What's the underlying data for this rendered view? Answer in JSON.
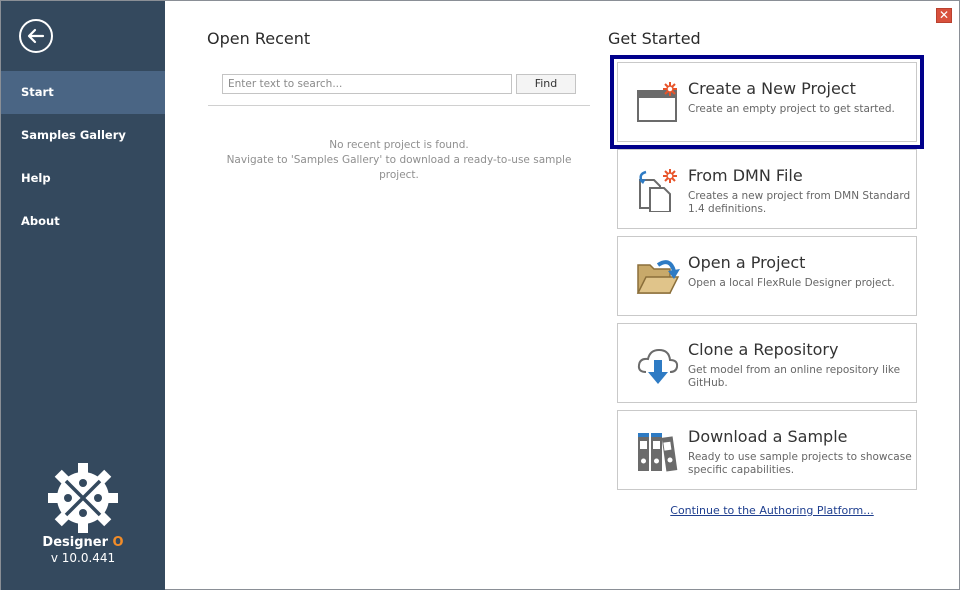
{
  "window": {
    "close_icon": "close-icon"
  },
  "sidebar": {
    "back_icon": "back-arrow-icon",
    "items": [
      {
        "label": "Start",
        "active": true
      },
      {
        "label": "Samples Gallery",
        "active": false
      },
      {
        "label": "Help",
        "active": false
      },
      {
        "label": "About",
        "active": false
      }
    ],
    "brand": {
      "name": "Designer",
      "name_suffix": "O",
      "version": "v 10.0.441"
    }
  },
  "open_recent": {
    "title": "Open Recent",
    "search_placeholder": "Enter text to search...",
    "search_value": "",
    "find_label": "Find",
    "empty_line1": "No recent project is found.",
    "empty_line2": "Navigate to 'Samples Gallery' to download a ready-to-use sample project."
  },
  "get_started": {
    "title": "Get Started",
    "cards": [
      {
        "icon": "new-project-icon",
        "title": "Create a New Project",
        "desc": "Create an empty project to get started.",
        "selected": true
      },
      {
        "icon": "dmn-file-icon",
        "title": "From DMN File",
        "desc": "Creates a new project from DMN Standard 1.4 definitions.",
        "selected": false
      },
      {
        "icon": "open-folder-icon",
        "title": "Open a Project",
        "desc": "Open a local FlexRule Designer project.",
        "selected": false
      },
      {
        "icon": "cloud-download-icon",
        "title": "Clone a Repository",
        "desc": "Get model from an online repository like GitHub.",
        "selected": false
      },
      {
        "icon": "binders-icon",
        "title": "Download a Sample",
        "desc": "Ready to use sample projects to showcase specific capabilities.",
        "selected": false
      }
    ],
    "continue_link": "Continue to the Authoring Platform..."
  },
  "colors": {
    "sidebar_bg": "#34495e",
    "sidebar_active": "#4a6584",
    "accent_orange": "#f28c28",
    "selection_outline": "#00008b"
  }
}
